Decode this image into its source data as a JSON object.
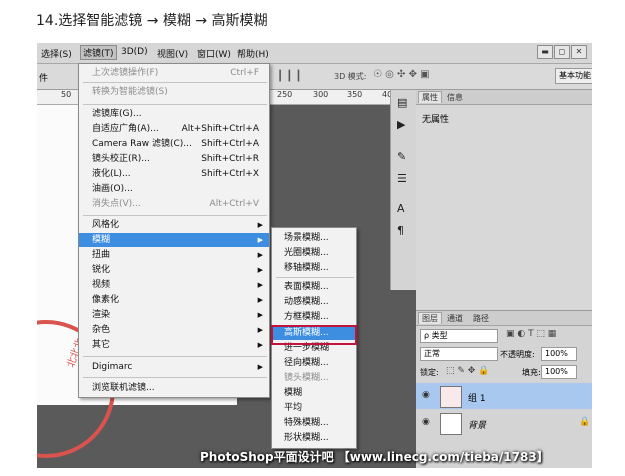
{
  "caption": "14.选择智能滤镜 → 模糊 → 高斯模糊",
  "menubar": {
    "items": [
      "选择(S)",
      "滤镜(T)",
      "3D(D)",
      "视图(V)",
      "窗口(W)",
      "帮助(H)"
    ],
    "active": "滤镜(T)",
    "window_buttons": [
      "▬",
      "◻",
      "✕"
    ]
  },
  "options_bar": {
    "left_label": "件",
    "mode3d_label": "3D 模式:",
    "workspace_button": "基本功能"
  },
  "ruler": {
    "ticks": [
      "50",
      "250",
      "300",
      "350",
      "400"
    ]
  },
  "filter_menu": {
    "items": [
      {
        "label": "上次滤镜操作(F)",
        "shortcut": "Ctrl+F",
        "disabled": true
      },
      {
        "label": "转换为智能滤镜(S)",
        "disabled": true
      },
      {
        "label": "滤镜库(G)..."
      },
      {
        "label": "自适应广角(A)...",
        "shortcut": "Alt+Shift+Ctrl+A"
      },
      {
        "label": "Camera Raw 滤镜(C)...",
        "shortcut": "Shift+Ctrl+A"
      },
      {
        "label": "镜头校正(R)...",
        "shortcut": "Shift+Ctrl+R"
      },
      {
        "label": "液化(L)...",
        "shortcut": "Shift+Ctrl+X"
      },
      {
        "label": "油画(O)..."
      },
      {
        "label": "消失点(V)...",
        "shortcut": "Alt+Ctrl+V",
        "disabled": true
      },
      {
        "label": "风格化",
        "submenu": true
      },
      {
        "label": "模糊",
        "submenu": true,
        "highlighted": true
      },
      {
        "label": "扭曲",
        "submenu": true
      },
      {
        "label": "锐化",
        "submenu": true
      },
      {
        "label": "视频",
        "submenu": true
      },
      {
        "label": "像素化",
        "submenu": true
      },
      {
        "label": "渲染",
        "submenu": true
      },
      {
        "label": "杂色",
        "submenu": true
      },
      {
        "label": "其它",
        "submenu": true
      },
      {
        "label": "Digimarc",
        "submenu": true
      },
      {
        "label": "浏览联机滤镜..."
      }
    ]
  },
  "blur_submenu": {
    "items": [
      {
        "label": "场景模糊..."
      },
      {
        "label": "光圈模糊..."
      },
      {
        "label": "移轴模糊..."
      },
      {
        "label": "表面模糊..."
      },
      {
        "label": "动感模糊..."
      },
      {
        "label": "方框模糊..."
      },
      {
        "label": "高斯模糊...",
        "highlighted": true
      },
      {
        "label": "进一步模糊"
      },
      {
        "label": "径向模糊..."
      },
      {
        "label": "镜头模糊...",
        "disabled": true
      },
      {
        "label": "模糊"
      },
      {
        "label": "平均"
      },
      {
        "label": "特殊模糊..."
      },
      {
        "label": "形状模糊..."
      }
    ]
  },
  "properties_panel": {
    "tabs": [
      "属性",
      "信息"
    ],
    "content": "无属性"
  },
  "layers_panel": {
    "tabs": [
      "图层",
      "通道",
      "路径"
    ],
    "kind_filter": "ρ 类型",
    "blend_mode": "正常",
    "opacity_label": "不透明度:",
    "opacity_value": "100%",
    "lock_label": "锁定:",
    "fill_label": "填充:",
    "fill_value": "100%",
    "layers": [
      {
        "name": "组 1",
        "selected": true
      },
      {
        "name": "背景",
        "locked": true
      }
    ]
  },
  "stamp_text": "北北北",
  "watermark": "PhotoShop平面设计吧 【www.linecg.com/tieba/1783】",
  "colors": {
    "highlight": "#3d8ee0",
    "annotation_box": "#c0143c",
    "stamp": "#d9534f"
  }
}
